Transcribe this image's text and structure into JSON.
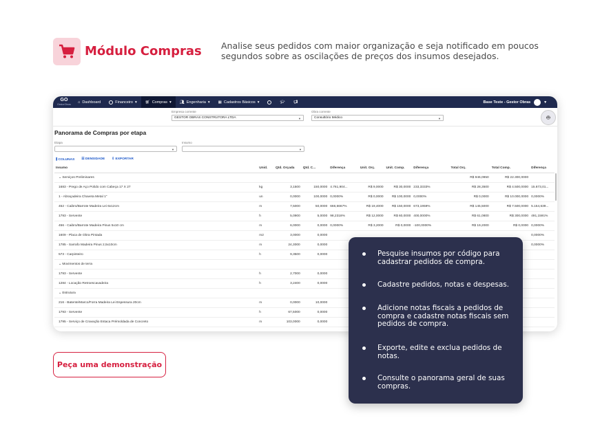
{
  "header": {
    "icon": "cart-icon",
    "title": "Módulo Compras",
    "description": "Analise seus pedidos com maior organização e seja notificado em poucos segundos sobre as oscilações de preços dos insumos desejados."
  },
  "colors": {
    "accent": "#d61f3f",
    "icon_bg": "#f8d3da",
    "nav": "#1f2a4f",
    "card": "#2c304d",
    "link": "#1a56c9"
  },
  "app": {
    "logo_top": "GO",
    "logo_bottom": "GestorObras",
    "nav": [
      {
        "label": "Dashboard",
        "icon": "home-icon"
      },
      {
        "label": "Financeiro",
        "icon": "money-icon"
      },
      {
        "label": "Compras",
        "icon": "cart-icon"
      },
      {
        "label": "Engenharia",
        "icon": "people-icon"
      },
      {
        "label": "Cadastros Básicos",
        "icon": "grid-icon"
      }
    ],
    "user": "Base Teste - Gestor Obras",
    "empresa_label": "Empresa corrente",
    "empresa_value": "GESTOR OBRAS CONSTRUTORA LTDA",
    "obra_label": "Obra corrente",
    "obra_value": "Consultório Médico",
    "panel_title": "Panorama de Compras por etapa",
    "filter_etapa": "Etapa",
    "filter_insumo": "Insumo",
    "toolbar": {
      "colunas": "COLUNAS",
      "densidade": "DENSIDADE",
      "exportar": "EXPORTAR"
    },
    "columns": [
      "Insumo",
      "Unid.",
      "Qtd. Orçada",
      "Qtd. C...",
      "Diferença",
      "Unit. Orç.",
      "Unit. Comp.",
      "Diferença",
      "Total Orç.",
      "Total Comp.",
      "Diferença"
    ],
    "rows": [
      {
        "group": true,
        "insumo": "Serviços Preliminares",
        "total_orc": "R$ 946,0950",
        "total_comp": "R$ 22.300,0000"
      },
      {
        "insumo": "1683 - Prego de Aço Polido com Cabeça 17 X 27",
        "unid": "kg",
        "qtd_orc": "3,1500",
        "qtd_comp": "150,0000",
        "dif": "4.761,904...",
        "unit_orc": "R$ 9,0000",
        "unit_comp": "R$ 30,0000",
        "dif_unit": "233,3333%",
        "dif_class": "red",
        "total_orc": "R$ 28,3500",
        "total_comp": "R$ 4.500,0000",
        "dif_total": "15.873,01..."
      },
      {
        "insumo": "1 - Abraçadeira Chaveta Metal 1\"",
        "unid": "un",
        "qtd_orc": "0,0000",
        "qtd_comp": "100,0000",
        "dif": "0,0000%",
        "unit_orc": "R$ 0,0000",
        "unit_comp": "R$ 100,0000",
        "dif_unit": "0,0000%",
        "dif_class": "",
        "total_orc": "R$ 0,0000",
        "total_comp": "R$ 10.000,0000",
        "dif_total": "0,0000%"
      },
      {
        "insumo": "452 - Caibro/Barrote Madeira Lei 6x12cm",
        "unid": "m",
        "qtd_orc": "7,5000",
        "qtd_comp": "50,0000",
        "dif": "666,6667%",
        "unit_orc": "R$ 19,4000",
        "unit_comp": "R$ 150,0000",
        "dif_unit": "673,1959%",
        "dif_class": "red",
        "total_orc": "R$ 145,5000",
        "total_comp": "R$ 7.500,0000",
        "dif_total": "5.154,639..."
      },
      {
        "insumo": "1793 - Servente",
        "unid": "h",
        "qtd_orc": "5,0900",
        "qtd_comp": "5,0000",
        "dif": "98,2318%",
        "unit_orc": "R$ 12,0000",
        "unit_comp": "R$ 60,0000",
        "dif_unit": "400,0000%",
        "dif_class": "red",
        "total_orc": "R$ 61,0800",
        "total_comp": "R$ 300,0000",
        "dif_total": "491,1591%"
      },
      {
        "insumo": "456 - Caibro/Barrote Madeira Pinus 5x10 cm",
        "unid": "m",
        "qtd_orc": "6,0000",
        "qtd_comp": "0,0000",
        "dif": "0,0000%",
        "unit_orc": "R$ 3,2000",
        "unit_comp": "R$ 0,0000",
        "dif_unit": "-100,0000%",
        "dif_class": "green",
        "total_orc": "R$ 19,2000",
        "total_comp": "R$ 0,0000",
        "dif_total": "0,0000%"
      },
      {
        "insumo": "1609 - Placa de Obra Pintada",
        "unid": "m2",
        "qtd_orc": "3,0000",
        "qtd_comp": "0,0000",
        "dif": "",
        "unit_orc": "",
        "unit_comp": "",
        "dif_unit": "",
        "dif_class": "",
        "total_orc": "",
        "total_comp": "",
        "dif_total": "0,0000%"
      },
      {
        "insumo": "1785 - Sarrafo Madeira Pinus 2,5x10cm",
        "unid": "m",
        "qtd_orc": "24,3000",
        "qtd_comp": "0,0000",
        "dif": "",
        "unit_orc": "",
        "unit_comp": "",
        "dif_unit": "",
        "dif_class": "",
        "total_orc": "",
        "total_comp": "",
        "dif_total": "0,0000%"
      },
      {
        "insumo": "573 - Carpinteiro",
        "unid": "h",
        "qtd_orc": "9,3500",
        "qtd_comp": "0,0000",
        "dif": "",
        "unit_orc": "",
        "unit_comp": "",
        "dif_unit": "",
        "dif_class": "",
        "total_orc": "",
        "total_comp": "",
        "dif_total": ""
      },
      {
        "group": true,
        "insumo": "Movimentos de terra",
        "total_orc": "",
        "total_comp": ""
      },
      {
        "insumo": "1793 - Servente",
        "unid": "h",
        "qtd_orc": "2,7000",
        "qtd_comp": "0,0000",
        "dif": "",
        "unit_orc": "",
        "unit_comp": "",
        "dif_unit": "",
        "dif_class": "",
        "total_orc": "",
        "total_comp": "",
        "dif_total": ""
      },
      {
        "insumo": "1284 - Locação Retroescavadeira",
        "unid": "h",
        "qtd_orc": "3,2400",
        "qtd_comp": "0,0000",
        "dif": "",
        "unit_orc": "",
        "unit_comp": "",
        "dif_unit": "",
        "dif_class": "",
        "total_orc": "",
        "total_comp": "",
        "dif_total": ""
      },
      {
        "group": true,
        "insumo": "Estrutura",
        "total_orc": "",
        "total_comp": ""
      },
      {
        "insumo": "216 - Batente/Marco/Forra Madeira Lei Espessura 20cm",
        "unid": "m",
        "qtd_orc": "0,0000",
        "qtd_comp": "10,0000",
        "dif": "",
        "unit_orc": "",
        "unit_comp": "",
        "dif_unit": "",
        "dif_class": "",
        "total_orc": "",
        "total_comp": "",
        "dif_total": ""
      },
      {
        "insumo": "1793 - Servente",
        "unid": "h",
        "qtd_orc": "67,5000",
        "qtd_comp": "0,0000",
        "dif": "",
        "unit_orc": "",
        "unit_comp": "",
        "dif_unit": "",
        "dif_class": "",
        "total_orc": "",
        "total_comp": "",
        "dif_total": ""
      },
      {
        "insumo": "1795 - Serviço de Cravação Estaca Prémoldada de Concreto",
        "unid": "m",
        "qtd_orc": "103,0000",
        "qtd_comp": "0,0000",
        "dif": "",
        "unit_orc": "",
        "unit_comp": "",
        "dif_unit": "",
        "dif_class": "",
        "total_orc": "",
        "total_comp": "",
        "dif_total": ""
      }
    ]
  },
  "cta": {
    "label": "Peça uma demonstração"
  },
  "features": [
    "Pesquise insumos por código para cadastrar pedidos de compra.",
    "Cadastre pedidos, notas e despesas.",
    "Adicione notas fiscais a pedidos de compra e cadastre notas fiscais sem pedidos de compra.",
    "Exporte, edite e exclua pedidos de notas.",
    "Consulte o panorama geral de suas compras."
  ]
}
